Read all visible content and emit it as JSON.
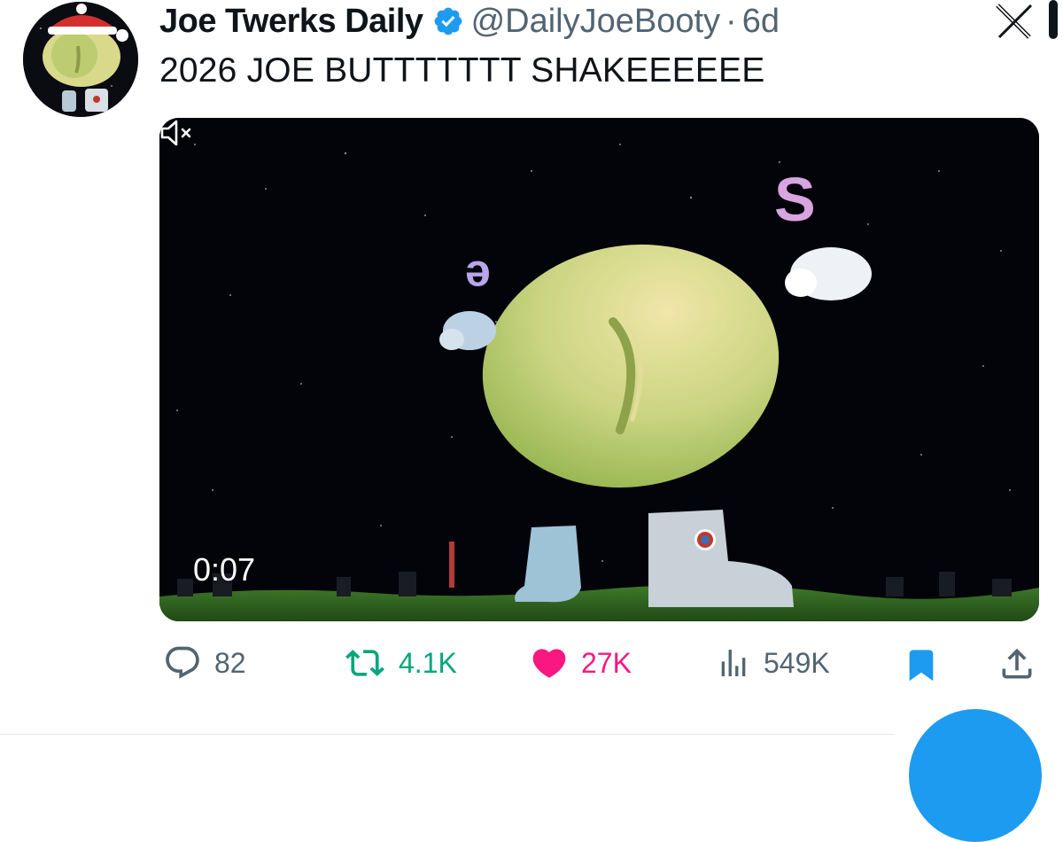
{
  "post": {
    "display_name": "Joe Twerks Daily",
    "handle": "@DailyJoeBooty",
    "separator": "·",
    "time": "6d",
    "text": "2026 JOE BUTTTTTTT SHAKEEEEEE",
    "verified": true
  },
  "media": {
    "type": "video",
    "timestamp": "0:07",
    "muted": true
  },
  "actions": {
    "replies": "82",
    "reposts": "4.1K",
    "likes": "27K",
    "views": "549K",
    "liked": true,
    "bookmarked": true
  },
  "colors": {
    "verified": "#1d9bf0",
    "repost": "#00a67d",
    "like": "#f91880",
    "bookmark": "#1d9bf0",
    "muted_text": "#536471"
  },
  "icons": [
    "verified-badge-icon",
    "x-logo-icon",
    "mute-icon",
    "reply-icon",
    "repost-icon",
    "like-icon",
    "views-icon",
    "bookmark-icon",
    "share-icon"
  ]
}
